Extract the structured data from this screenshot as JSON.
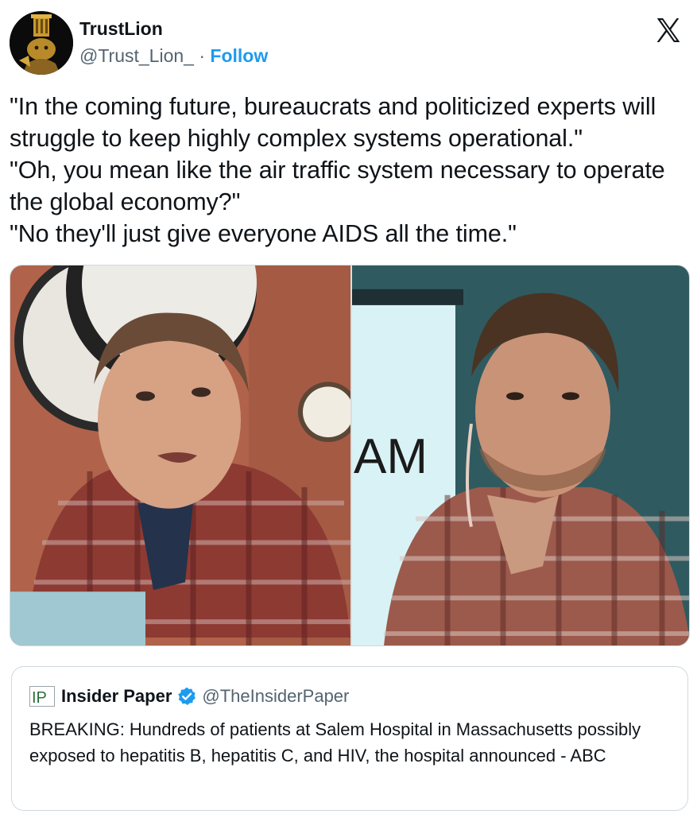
{
  "author": {
    "display_name": "TrustLion",
    "handle": "@Trust_Lion_",
    "separator": " · ",
    "follow_label": "Follow",
    "avatar_icon": "lion-avatar-icon"
  },
  "brand_icon": "x-logo-icon",
  "tweet": {
    "text": "\"In the coming future, bureaucrats and politicized experts will struggle to keep highly complex systems operational.\"\n\"Oh, you mean like the air traffic system necessary to operate the global economy?\"\n\"No they'll just give everyone AIDS all the time.\""
  },
  "media": {
    "left_photo": {
      "subject": "man-in-plaid-shirt-clock-background"
    },
    "right_photo": {
      "subject": "man-in-plaid-shirt-with-earpiece",
      "sign_text": "AM"
    }
  },
  "quote": {
    "logo_text": "IP",
    "name": "Insider Paper",
    "verified_icon": "verified-badge-icon",
    "handle": "@TheInsiderPaper",
    "text": "BREAKING: Hundreds of patients at Salem Hospital in Massachusetts possibly exposed to hepatitis B, hepatitis C, and HIV, the hospital announced - ABC"
  },
  "colors": {
    "follow": "#1d9bf0",
    "secondary_text": "#536471",
    "border": "#cfd9de",
    "verified": "#1d9bf0"
  }
}
